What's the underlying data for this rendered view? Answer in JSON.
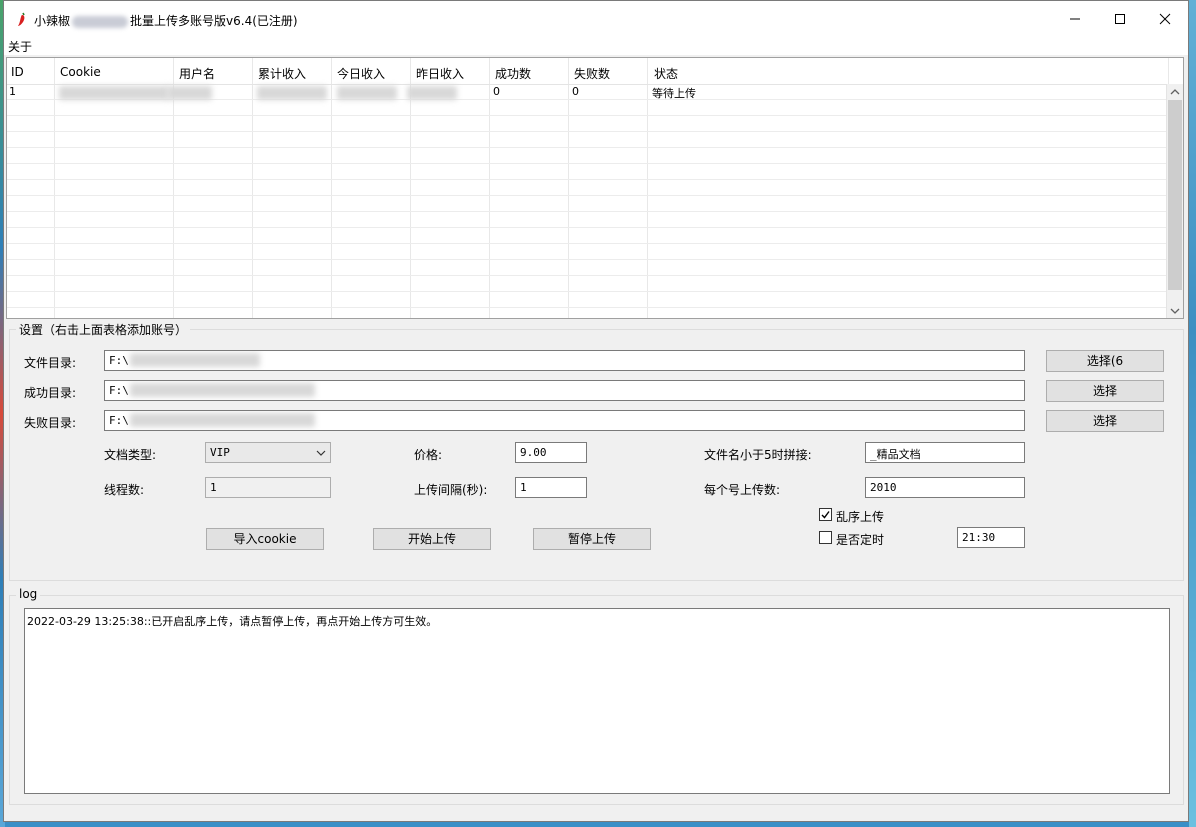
{
  "window": {
    "title_prefix": "小辣椒",
    "title_suffix": "批量上传多账号版v6.4(已注册)",
    "minimize": "—",
    "maximize": "☐",
    "close": "✕"
  },
  "menu": {
    "about": "关于"
  },
  "table": {
    "headers": [
      "ID",
      "Cookie",
      "用户名",
      "累计收入",
      "今日收入",
      "昨日收入",
      "成功数",
      "失败数",
      "状态"
    ],
    "rows": [
      {
        "id": "1",
        "success": "0",
        "fail": "0",
        "status": "等待上传"
      }
    ]
  },
  "settings": {
    "title": "设置（右击上面表格添加账号）",
    "file_dir_label": "文件目录:",
    "file_dir_value": "F:\\",
    "success_dir_label": "成功目录:",
    "success_dir_value": "F:\\",
    "fail_dir_label": "失败目录:",
    "fail_dir_value": "F:\\",
    "choose_1": "选择(6",
    "choose_2": "选择",
    "choose_3": "选择",
    "doc_type_label": "文档类型:",
    "doc_type_value": "VIP",
    "price_label": "价格:",
    "price_value": "9.00",
    "concat_label": "文件名小于5时拼接:",
    "concat_value": "_精品文档",
    "threads_label": "线程数:",
    "threads_value": "1",
    "interval_label": "上传间隔(秒):",
    "interval_value": "1",
    "per_account_label": "每个号上传数:",
    "per_account_value": "2010",
    "shuffle_label": "乱序上传",
    "shuffle_checked": true,
    "timed_label": "是否定时",
    "timed_checked": false,
    "time_value": "21:30",
    "import_btn": "导入cookie",
    "start_btn": "开始上传",
    "pause_btn": "暂停上传"
  },
  "log": {
    "title": "log",
    "text": "2022-03-29 13:25:38::已开启乱序上传，请点暂停上传，再点开始上传方可生效。"
  }
}
